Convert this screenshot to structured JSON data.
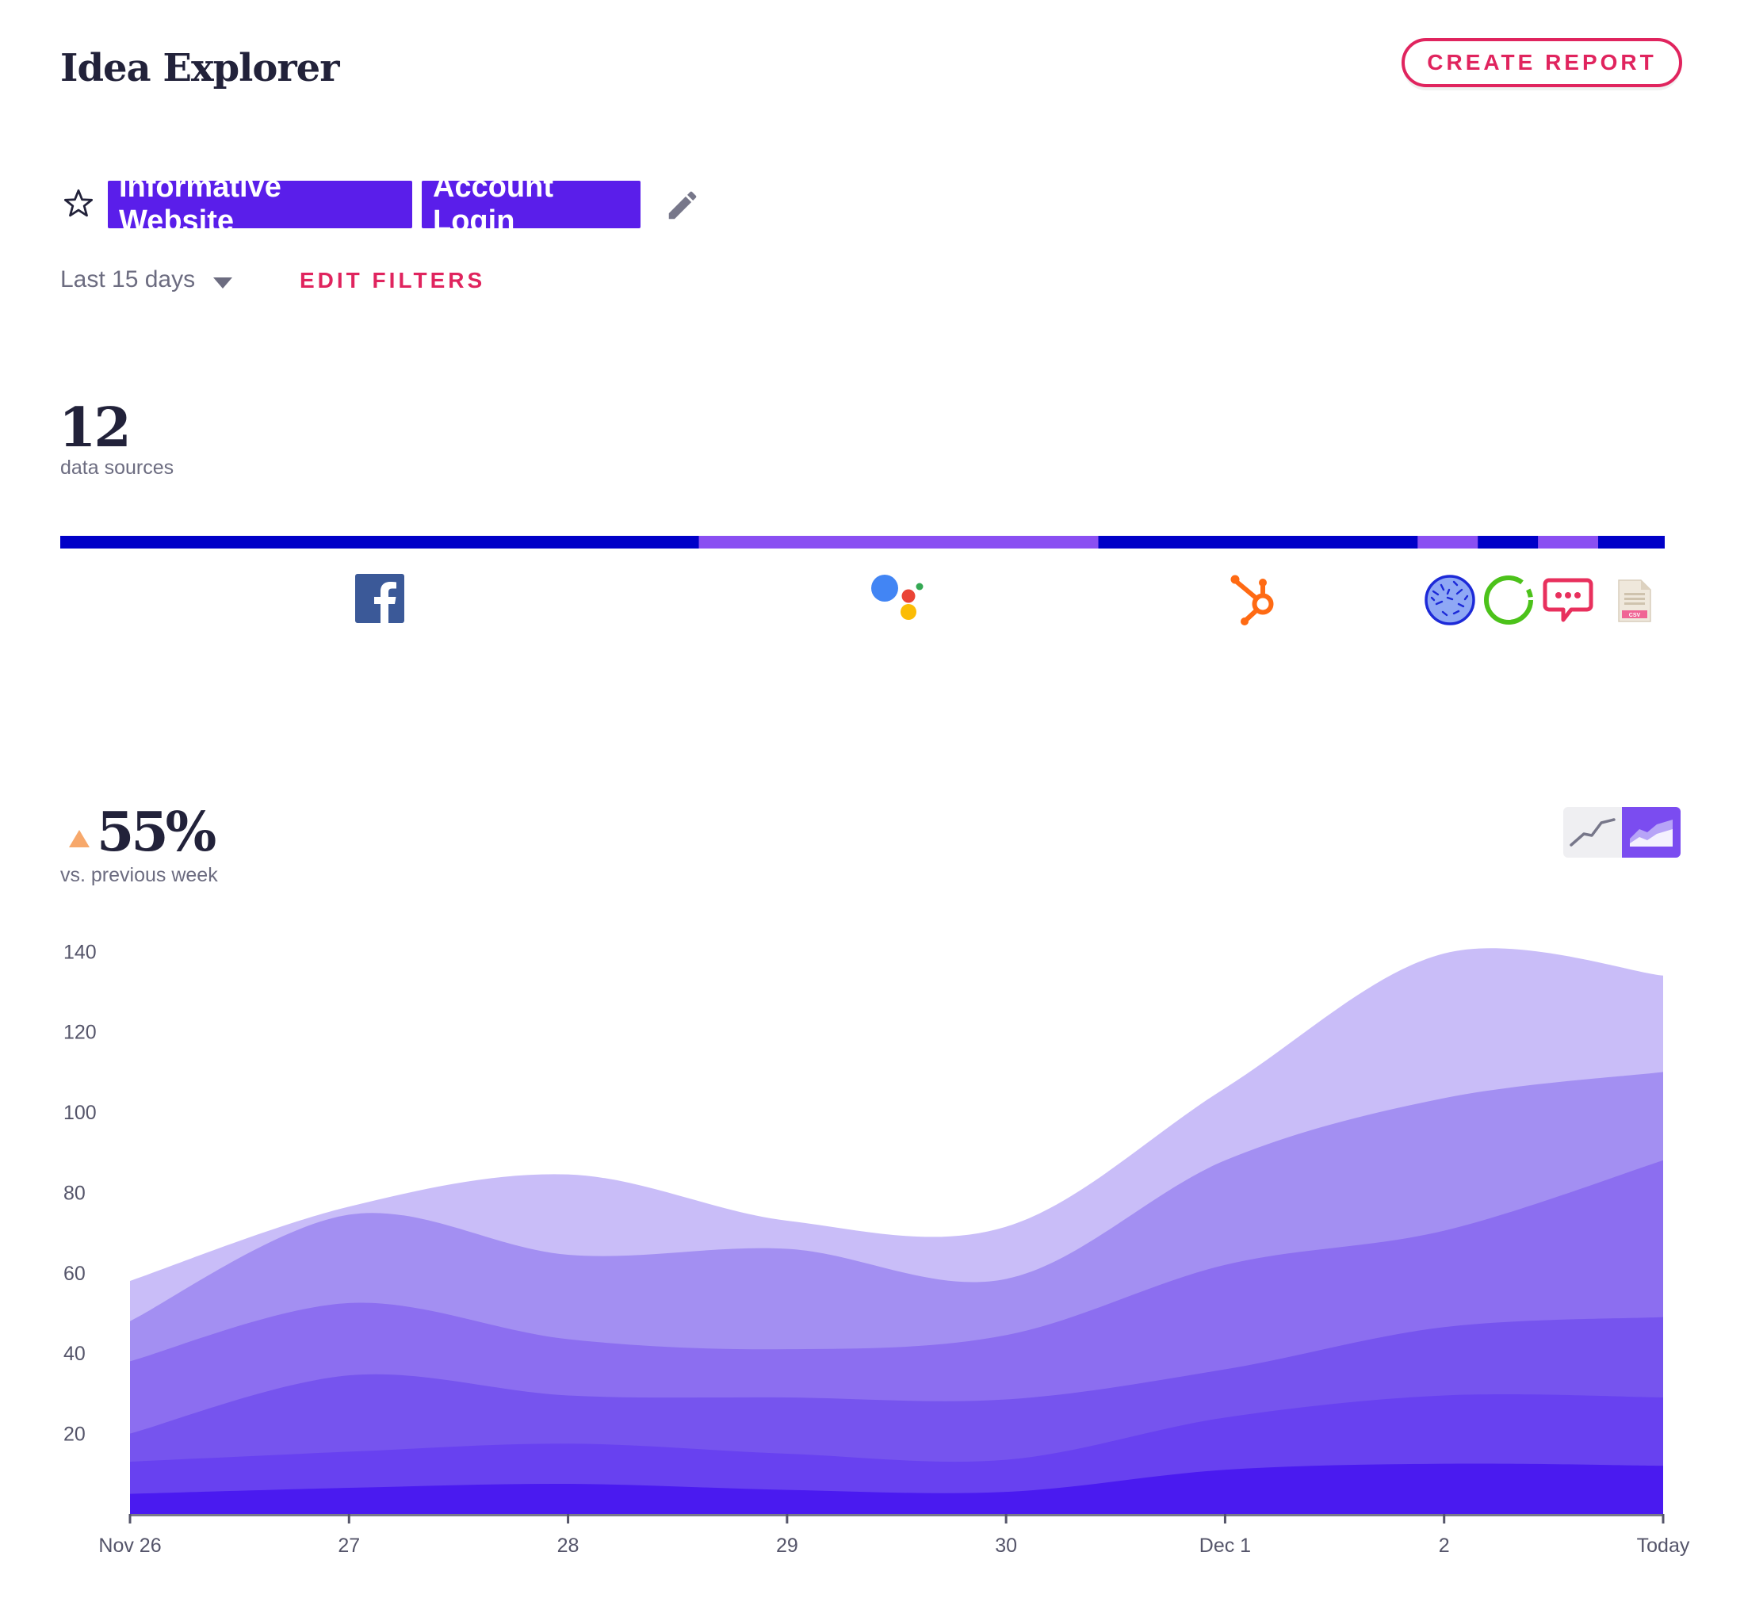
{
  "header": {
    "title": "Idea Explorer",
    "create_report_label": "CREATE REPORT"
  },
  "filters": {
    "tags": [
      "Informative Website",
      "Account Login"
    ],
    "date_range": "Last 15 days",
    "edit_filters_label": "EDIT FILTERS"
  },
  "sources": {
    "count": "12",
    "label": "data sources",
    "segments": [
      {
        "fraction": 0.398,
        "color": "#0000c8"
      },
      {
        "fraction": 0.249,
        "color": "#8a4ff2"
      },
      {
        "fraction": 0.199,
        "color": "#0000c8"
      },
      {
        "fraction": 0.0375,
        "color": "#8a4ff2"
      },
      {
        "fraction": 0.0375,
        "color": "#0000c8"
      },
      {
        "fraction": 0.0375,
        "color": "#8a4ff2"
      },
      {
        "fraction": 0.0415,
        "color": "#0000c8"
      }
    ],
    "icons": [
      "facebook-icon",
      "google-assistant-icon",
      "hubspot-icon",
      "globe-icon",
      "circular-loader-icon",
      "chat-bubble-icon",
      "csv-file-icon"
    ]
  },
  "trend": {
    "arrow": "up",
    "value": "55%",
    "label": "vs. previous week",
    "view_toggle": [
      "line-chart-icon",
      "area-chart-icon"
    ],
    "active_view": "area"
  },
  "chart_data": {
    "type": "area",
    "stacked": true,
    "x": [
      "Nov 26",
      "27",
      "28",
      "29",
      "30",
      "Dec 1",
      "2",
      "Today"
    ],
    "ylim": [
      0,
      145
    ],
    "yticks": [
      20,
      40,
      60,
      80,
      100,
      120,
      140
    ],
    "colors": [
      "#4a1af0",
      "#6841f0",
      "#7654ee",
      "#8c6ef0",
      "#a38ff2",
      "#c9bdf8"
    ],
    "series": [
      {
        "values": [
          5,
          6.5,
          7.5,
          6,
          5.5,
          11,
          12.5,
          12
        ]
      },
      {
        "values": [
          8,
          9,
          10,
          9,
          8,
          13,
          17,
          17
        ]
      },
      {
        "values": [
          7,
          19,
          12,
          14,
          15,
          12,
          17,
          20
        ]
      },
      {
        "values": [
          18,
          18,
          14,
          12,
          16,
          26,
          24,
          39
        ]
      },
      {
        "values": [
          10,
          22,
          21,
          25,
          14,
          26,
          33,
          22
        ]
      },
      {
        "values": [
          10,
          2,
          20,
          7,
          13,
          18,
          36,
          24
        ]
      }
    ]
  }
}
